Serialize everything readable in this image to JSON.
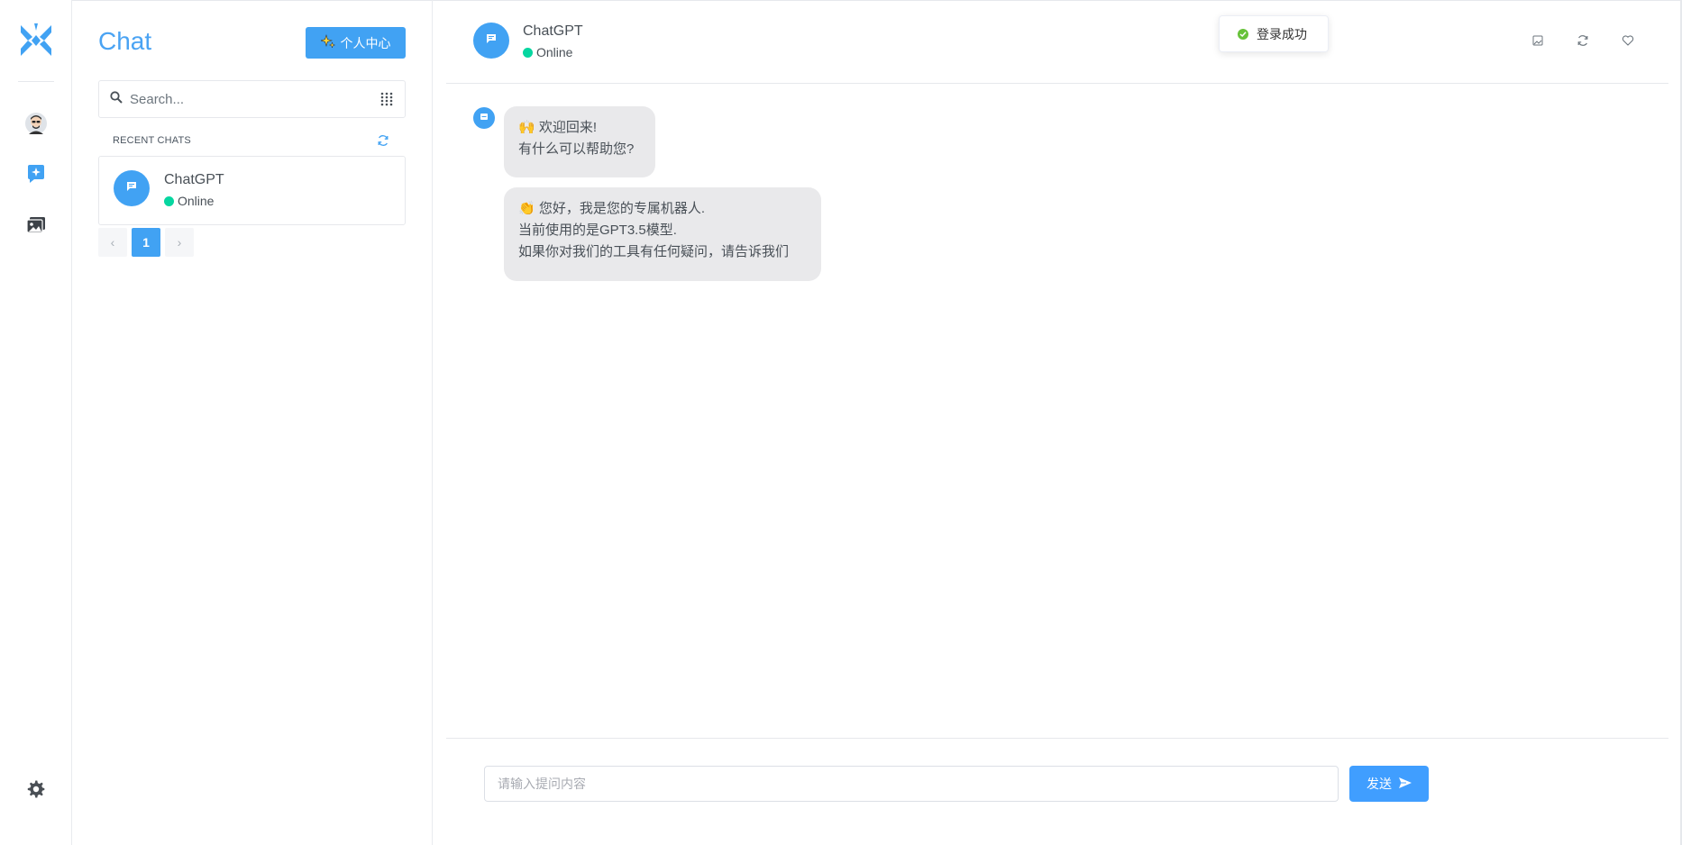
{
  "colors": {
    "accent": "#41a2f3",
    "online": "#06d6a0",
    "success": "#67c23a",
    "bubble": "#e9e9eb"
  },
  "sidebar": {
    "title": "Chat",
    "profile_button": "个人中心",
    "search_placeholder": "Search...",
    "recent_heading": "RECENT CHATS",
    "chats": [
      {
        "name": "ChatGPT",
        "status": "Online"
      }
    ],
    "pagination": {
      "prev": "‹",
      "current": "1",
      "next": "›"
    }
  },
  "header": {
    "name": "ChatGPT",
    "status": "Online"
  },
  "toast": {
    "text": "登录成功"
  },
  "messages": [
    {
      "lines": [
        "🙌 欢迎回来!",
        "有什么可以帮助您?"
      ]
    },
    {
      "lines": [
        "👏 您好，我是您的专属机器人.",
        "当前使用的是GPT3.5模型.",
        "如果你对我们的工具有任何疑问，请告诉我们"
      ]
    }
  ],
  "composer": {
    "placeholder": "请输入提问内容",
    "send_label": "发送"
  },
  "icons": [
    "logo-icon",
    "avatar",
    "chat-icon",
    "gallery-icon",
    "settings-icon",
    "search-icon",
    "grid-icon",
    "refresh-icon",
    "message-icon",
    "image-icon",
    "heart-icon",
    "send-icon",
    "check-icon"
  ]
}
